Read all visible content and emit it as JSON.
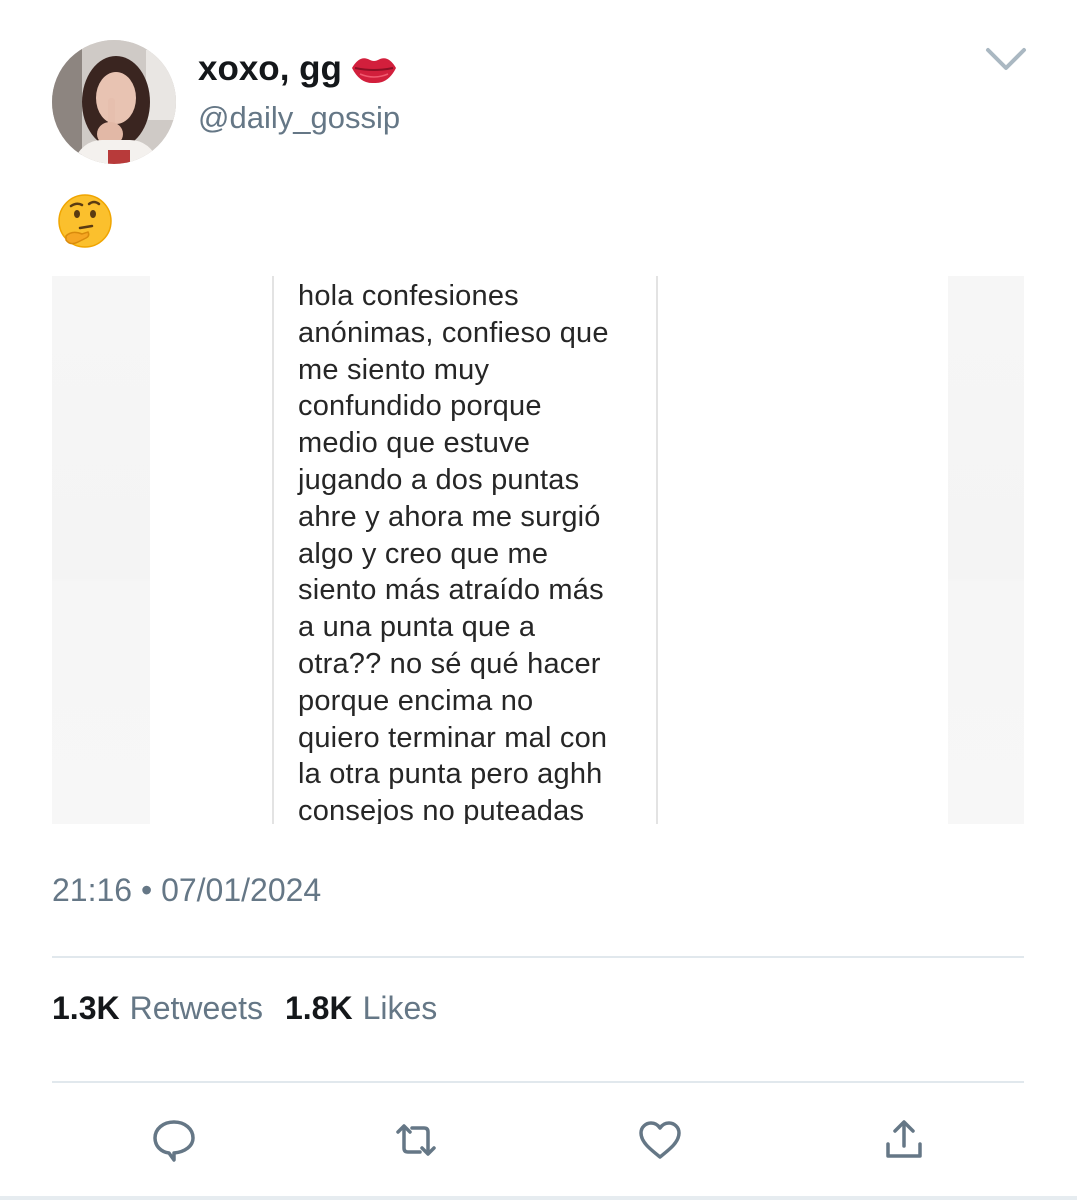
{
  "tweet": {
    "display_name": "xoxo, gg",
    "handle": "@daily_gossip",
    "text_emoji": "thinking-face",
    "name_emoji": "kiss-mark",
    "timestamp": "21:16 • 07/01/2024",
    "media": {
      "confession_text": "hola confesiones\nanónimas, confieso que\nme siento muy\nconfundido porque\nmedio que estuve\njugando a dos puntas\nahre y ahora me surgió\nalgo y creo que me\nsiento más atraído más\na una punta que a\notra?? no sé qué hacer\nporque encima no\nquiero terminar mal con\nla otra punta pero aghh\nconsejos no puteadas"
    },
    "stats": {
      "retweets_count": "1.3K",
      "retweets_label": "Retweets",
      "likes_count": "1.8K",
      "likes_label": "Likes"
    },
    "actions": {
      "reply_icon": "reply-icon",
      "retweet_icon": "retweet-icon",
      "like_icon": "heart-icon",
      "share_icon": "share-icon"
    }
  },
  "colors": {
    "secondary_text": "#657786",
    "primary_text": "#14171a",
    "divider": "#e1e8ed"
  }
}
